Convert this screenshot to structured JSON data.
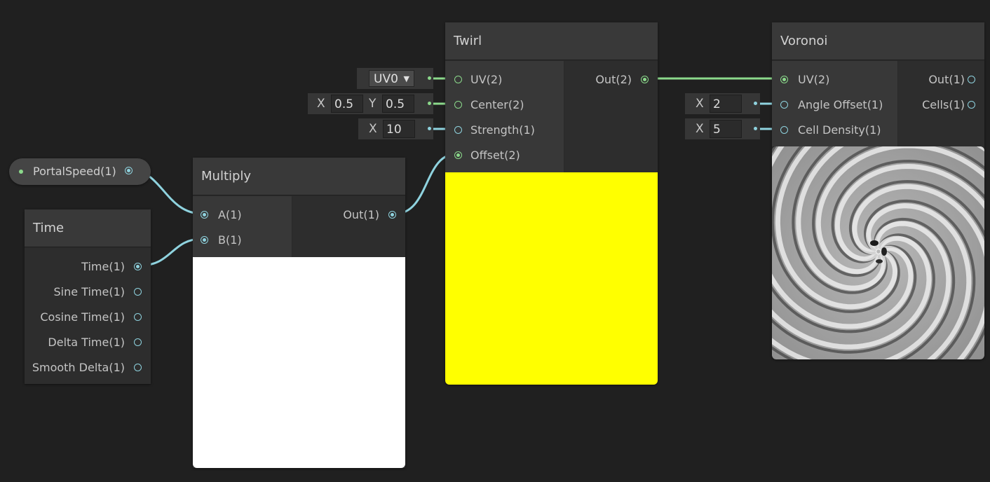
{
  "property_node": {
    "label": "PortalSpeed(1)"
  },
  "time_node": {
    "title": "Time",
    "outputs": [
      "Time(1)",
      "Sine Time(1)",
      "Cosine Time(1)",
      "Delta Time(1)",
      "Smooth Delta(1)"
    ]
  },
  "multiply_node": {
    "title": "Multiply",
    "inputs": [
      "A(1)",
      "B(1)"
    ],
    "output": "Out(1)",
    "preview_color": "#ffffff"
  },
  "twirl_node": {
    "title": "Twirl",
    "inputs": [
      "UV(2)",
      "Center(2)",
      "Strength(1)",
      "Offset(2)"
    ],
    "output": "Out(2)",
    "preview_color": "#ffff00",
    "uv_dropdown": "UV0",
    "center": {
      "x_label": "X",
      "x": "0.5",
      "y_label": "Y",
      "y": "0.5"
    },
    "strength": {
      "x_label": "X",
      "x": "10"
    }
  },
  "voronoi_node": {
    "title": "Voronoi",
    "inputs": [
      "UV(2)",
      "Angle Offset(1)",
      "Cell Density(1)"
    ],
    "outputs": [
      "Out(1)",
      "Cells(1)"
    ],
    "angle_offset": {
      "x_label": "X",
      "x": "2"
    },
    "cell_density": {
      "x_label": "X",
      "x": "5"
    }
  },
  "colors": {
    "background": "#202020",
    "wire_float": "#8fd3df",
    "wire_vector2": "#8bd98b",
    "node_title": "#393939"
  }
}
